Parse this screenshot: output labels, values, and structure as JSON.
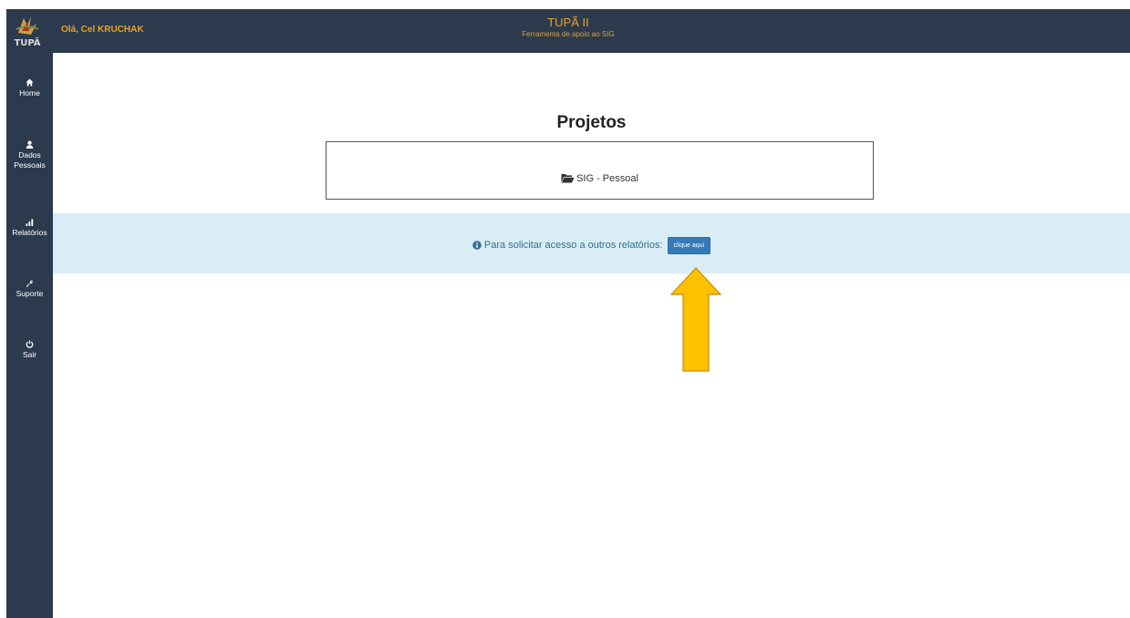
{
  "header": {
    "greeting": "Olá, Cel KRUCHAK",
    "title": "TUPÃ II",
    "subtitle": "Ferramenta de apoio ao SIG",
    "logo_text": "TUPÃ"
  },
  "sidebar": {
    "items": [
      {
        "label": "Home",
        "icon": "home-icon"
      },
      {
        "label": "Dados Pessoais",
        "icon": "user-icon"
      },
      {
        "label": "Relatórios",
        "icon": "bar-chart-icon"
      },
      {
        "label": "Suporte",
        "icon": "wrench-icon"
      },
      {
        "label": "Sair",
        "icon": "power-icon"
      }
    ]
  },
  "main": {
    "title": "Projetos",
    "projects": [
      {
        "label": "SIG - Pessoal",
        "icon": "folder-open-icon"
      }
    ],
    "info": {
      "text": "Para solicitar acesso a outros relatórios:",
      "button_label": "clique aqui",
      "icon": "info-icon"
    }
  },
  "colors": {
    "bar_bg": "#2c3a4d",
    "accent": "#f0a020",
    "info_bg": "#d9edf6",
    "info_text": "#31708f",
    "button": "#337ab7",
    "arrow": "#ffc000"
  }
}
